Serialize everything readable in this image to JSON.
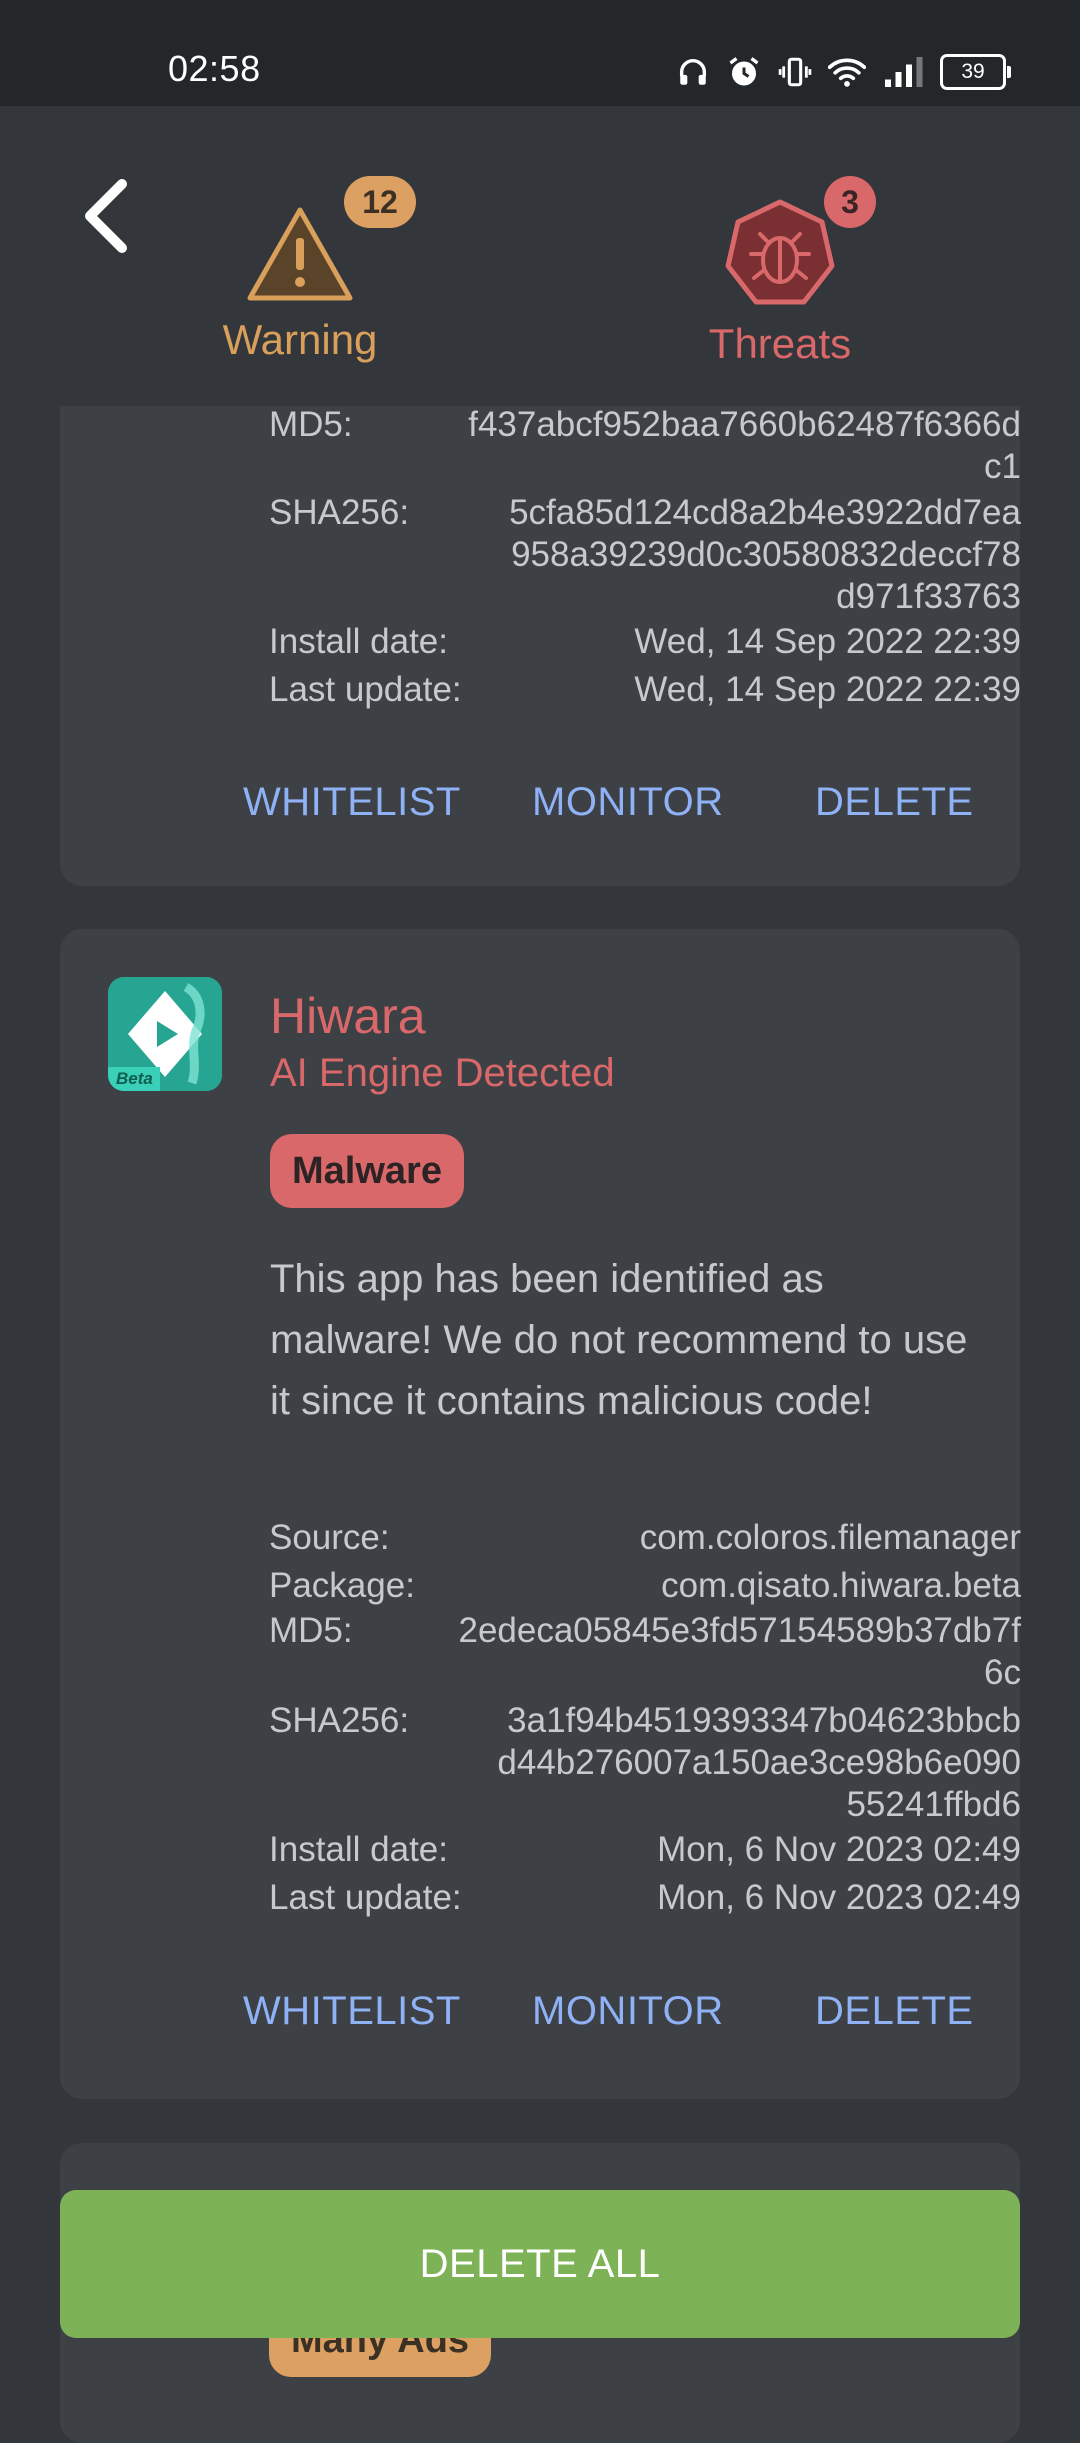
{
  "status_bar": {
    "time": "02:58",
    "battery": "39",
    "icons": [
      "headphones-icon",
      "alarm-icon",
      "vibrate-icon",
      "wifi-icon",
      "signal-icon",
      "battery-icon"
    ]
  },
  "header": {
    "warning": {
      "count": "12",
      "label": "Warning",
      "color": "#d9a05b"
    },
    "threats": {
      "count": "3",
      "label": "Threats",
      "color": "#d9686a"
    }
  },
  "actions": {
    "whitelist": "WHITELIST",
    "monitor": "MONITOR",
    "delete": "DELETE"
  },
  "card1": {
    "md5_label": "MD5:",
    "md5": "f437abcf952baa7660b62487f6366d\nc1",
    "sha_label": "SHA256:",
    "sha256": "5cfa85d124cd8a2b4e3922dd7ea\n958a39239d0c30580832deccf78\nd971f33763",
    "install_label": "Install date:",
    "install": "Wed, 14 Sep 2022 22:39",
    "update_label": "Last update:",
    "update": "Wed, 14 Sep 2022 22:39"
  },
  "card2": {
    "app_name": "Hiwara",
    "subtitle": "AI Engine Detected",
    "icon_badge": "Beta",
    "tag": "Malware",
    "description": "This app has been identified as malware! We do not recommend to use it since it contains malicious code!",
    "source_label": "Source:",
    "source": "com.coloros.filemanager",
    "package_label": "Package:",
    "package": "com.qisato.hiwara.beta",
    "md5_label": "MD5:",
    "md5": "2edeca05845e3fd57154589b37db7f\n6c",
    "sha_label": "SHA256:",
    "sha256": "3a1f94b4519393347b04623bbcb\nd44b276007a150ae3ce98b6e090\n55241ffbd6",
    "install_label": "Install date:",
    "install": "Mon, 6 Nov 2023 02:49",
    "update_label": "Last update:",
    "update": "Mon, 6 Nov 2023 02:49"
  },
  "card3": {
    "tag": "Many Ads"
  },
  "delete_all": "DELETE ALL"
}
